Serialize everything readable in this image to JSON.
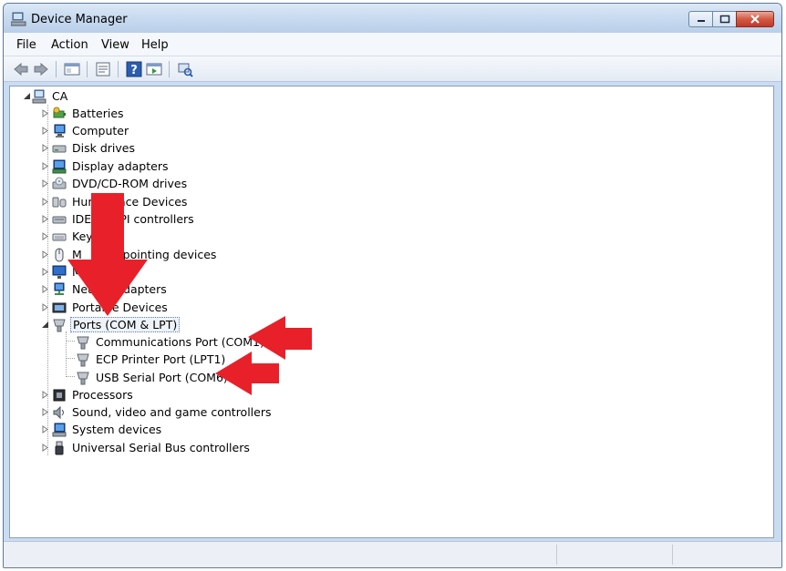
{
  "window": {
    "title": "Device Manager",
    "caption_buttons": [
      "minimize",
      "maximize",
      "close"
    ]
  },
  "menu": [
    "File",
    "Action",
    "View",
    "Help"
  ],
  "toolbar": {
    "icons": [
      "back-arrow-icon",
      "forward-arrow-icon",
      "show-hide-tree-icon",
      "properties-icon",
      "help-icon",
      "run-icon",
      "scan-hardware-icon"
    ]
  },
  "tree": {
    "root": {
      "label": "CA",
      "icon": "computer-icon",
      "expanded": true
    },
    "categories": [
      {
        "label": "Batteries",
        "icon": "battery-icon",
        "expanded": false
      },
      {
        "label": "Computer",
        "icon": "monitor-icon",
        "expanded": false
      },
      {
        "label": "Disk drives",
        "icon": "disk-drive-icon",
        "expanded": false
      },
      {
        "label": "Display adapters",
        "icon": "display-adapter-icon",
        "expanded": false
      },
      {
        "label": "DVD/CD-ROM drives",
        "icon": "dvd-drive-icon",
        "expanded": false
      },
      {
        "label": "Hum   rface Devices",
        "icon": "hid-icon",
        "expanded": false
      },
      {
        "label": "IDE    TAPI controllers",
        "icon": "ide-controller-icon",
        "expanded": false
      },
      {
        "label": "Key",
        "icon": "keyboard-icon",
        "expanded": false
      },
      {
        "label": "M         r pointing devices",
        "icon": "mouse-icon",
        "expanded": false
      },
      {
        "label": "Mo",
        "icon": "monitor-icon",
        "expanded": false
      },
      {
        "label": "Netw      dapters",
        "icon": "network-adapter-icon",
        "expanded": false
      },
      {
        "label": "Portable Devices",
        "icon": "portable-device-icon",
        "expanded": false
      },
      {
        "label": "Ports (COM & LPT)",
        "icon": "port-icon",
        "expanded": true,
        "selected": true,
        "children": [
          {
            "label": "Communications Port (COM1)",
            "icon": "port-icon"
          },
          {
            "label": "ECP Printer Port (LPT1)",
            "icon": "port-icon"
          },
          {
            "label": "USB Serial Port (COM6)",
            "icon": "port-icon"
          }
        ]
      },
      {
        "label": "Processors",
        "icon": "processor-icon",
        "expanded": false
      },
      {
        "label": "Sound, video and game controllers",
        "icon": "speaker-icon",
        "expanded": false
      },
      {
        "label": "System devices",
        "icon": "system-device-icon",
        "expanded": false
      },
      {
        "label": "Universal Serial Bus controllers",
        "icon": "usb-icon",
        "expanded": false
      }
    ]
  },
  "annotations": {
    "arrow_color": "#e8202a",
    "arrows": [
      "down-arrow-to-ports",
      "left-arrow-to-com1",
      "left-arrow-to-com6"
    ]
  },
  "colors": {
    "selection_border": "#5c7fb5",
    "titlebar": "#c6d9ef",
    "close_button": "#c0392b"
  }
}
